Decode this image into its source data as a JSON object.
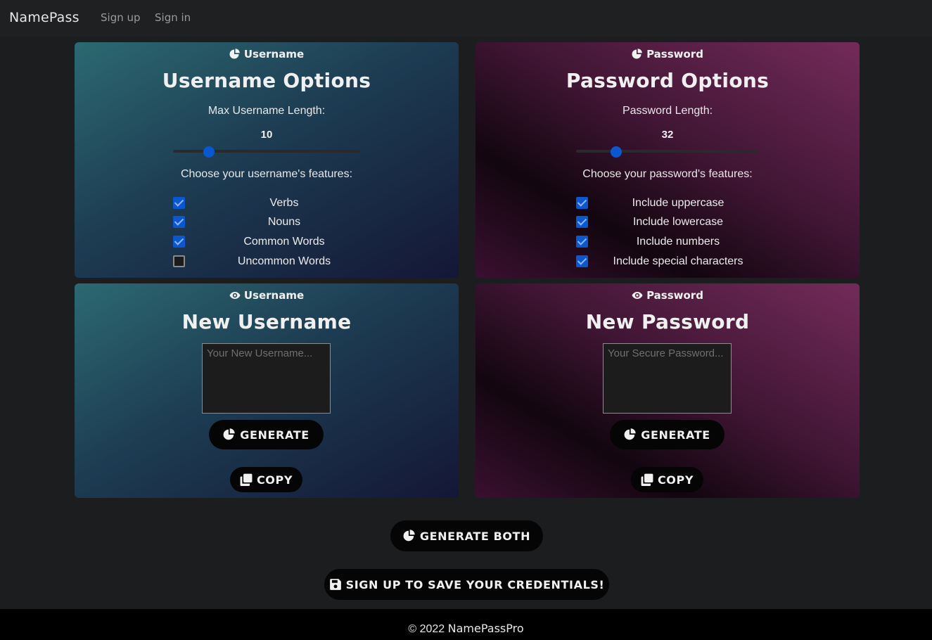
{
  "navbar": {
    "brand": "NamePass",
    "links": [
      "Sign up",
      "Sign in"
    ]
  },
  "username_options": {
    "tag": "Username",
    "title": "Username Options",
    "length_label": "Max Username Length:",
    "length_value": 10,
    "slider_fraction": 0.19,
    "features_label": "Choose your username's features:",
    "features": [
      {
        "label": "Verbs",
        "checked": true
      },
      {
        "label": "Nouns",
        "checked": true
      },
      {
        "label": "Common Words",
        "checked": true
      },
      {
        "label": "Uncommon Words",
        "checked": false
      }
    ]
  },
  "password_options": {
    "tag": "Password",
    "title": "Password Options",
    "length_label": "Password Length:",
    "length_value": 32,
    "slider_fraction": 0.22,
    "features_label": "Choose your password's features:",
    "features": [
      {
        "label": "Include uppercase",
        "checked": true
      },
      {
        "label": "Include lowercase",
        "checked": true
      },
      {
        "label": "Include numbers",
        "checked": true
      },
      {
        "label": "Include special characters",
        "checked": true
      }
    ]
  },
  "new_username": {
    "tag": "Username",
    "title": "New Username",
    "placeholder": "Your New Username...",
    "value": "",
    "generate_label": "GENERATE",
    "copy_label": "COPY"
  },
  "new_password": {
    "tag": "Password",
    "title": "New Password",
    "placeholder": "Your Secure Password...",
    "value": "",
    "generate_label": "GENERATE",
    "copy_label": "COPY"
  },
  "actions": {
    "generate_both": "GENERATE BOTH",
    "signup_save": "SIGN UP TO SAVE YOUR CREDENTIALS!"
  },
  "footer": {
    "copyright": "© 2022",
    "brand": "NamePassPro"
  },
  "colors": {
    "accent_blue": "#0b57d0",
    "username_gradient": "#2c6971",
    "password_gradient": "#732b59",
    "button_bg": "#050505"
  },
  "icons": {
    "card_options": "pie-chart-icon",
    "card_output": "eye-icon",
    "generate": "pie-chart-icon",
    "copy": "copy-icon",
    "save": "floppy-disk-icon"
  }
}
